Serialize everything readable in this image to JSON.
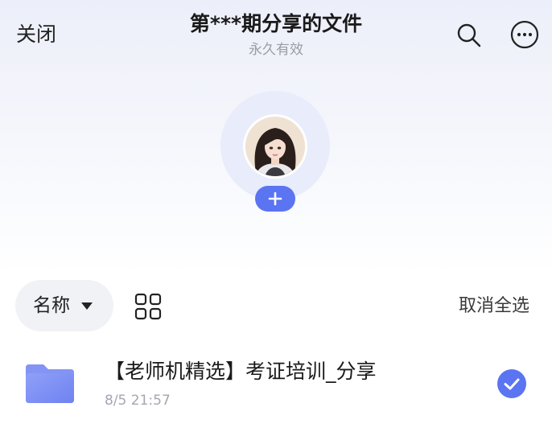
{
  "header": {
    "close_label": "关闭",
    "title": "第***期分享的文件",
    "subtitle": "永久有效",
    "search_icon": "search-icon",
    "more_icon": "more-horizontal-icon"
  },
  "members": {
    "avatar_icon": "user-avatar",
    "add_icon": "plus-icon"
  },
  "toolbar": {
    "sort_label": "名称",
    "sort_icon": "caret-down-icon",
    "view_toggle_icon": "grid-view-icon",
    "deselect_all_label": "取消全选"
  },
  "files": [
    {
      "icon": "folder-icon",
      "name": "【老师机精选】考证培训_分享",
      "time": "8/5 21:57",
      "selected": true
    }
  ],
  "colors": {
    "accent": "#5a74f2",
    "folder": "#7d8ef5",
    "muted_text": "#9a9ca6"
  }
}
